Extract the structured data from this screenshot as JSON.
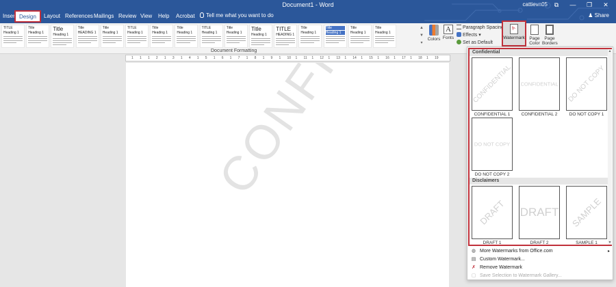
{
  "titlebar": {
    "title": "Document1 - Word",
    "user": "cattievn05",
    "buttons": {
      "ribbon_options": "⧉",
      "minimize": "—",
      "restore": "❐",
      "close": "✕"
    }
  },
  "tabs": [
    {
      "label": "Insert"
    },
    {
      "label": "Design",
      "active": true
    },
    {
      "label": "Layout"
    },
    {
      "label": "References"
    },
    {
      "label": "Mailings"
    },
    {
      "label": "Review"
    },
    {
      "label": "View"
    },
    {
      "label": "Help"
    },
    {
      "label": "Acrobat"
    }
  ],
  "tell_me": "Tell me what you want to do",
  "share": "Share",
  "style_gallery": {
    "items": [
      {
        "title": "TITLE",
        "heading": "Heading 1",
        "big": false
      },
      {
        "title": "Title",
        "heading": "Heading 1",
        "big": false
      },
      {
        "title": "Title",
        "heading": "Heading 1",
        "big": true
      },
      {
        "title": "Title",
        "heading": "HEADING 1",
        "big": false
      },
      {
        "title": "Title",
        "heading": "Heading 1",
        "big": false
      },
      {
        "title": "TITLE",
        "heading": "Heading 1",
        "big": false
      },
      {
        "title": "Title",
        "heading": "Heading 1",
        "big": false
      },
      {
        "title": "Title",
        "heading": "Heading 1",
        "big": false
      },
      {
        "title": "TITLE",
        "heading": "Heading 1",
        "big": false
      },
      {
        "title": "Title",
        "heading": "Heading 1",
        "big": false
      },
      {
        "title": "Title",
        "heading": "Heading 1",
        "big": true
      },
      {
        "title": "TITLE",
        "heading": "HEADING 1",
        "big": true
      },
      {
        "title": "Title",
        "heading": "Heading 1",
        "big": false
      },
      {
        "title": "Title",
        "heading": "Heading 1",
        "big": false
      },
      {
        "title": "Title",
        "heading": "Heading 1",
        "big": false
      },
      {
        "title": "Title",
        "heading": "Heading 1",
        "big": false
      }
    ],
    "label": "Document Formatting"
  },
  "ribbon": {
    "colors": "Colors",
    "fonts": "Fonts",
    "fonts_icon": "A",
    "paragraph_spacing": "Paragraph Spacing ▾",
    "effects": "Effects ▾",
    "set_default": "Set as Default",
    "watermark": "Watermark",
    "page_color": "Page Color ▾",
    "page_borders": "Page Borders"
  },
  "ruler": {
    "ticks": [
      "1",
      "1",
      "1",
      "2",
      "1",
      "3",
      "1",
      "4",
      "1",
      "5",
      "1",
      "6",
      "1",
      "7",
      "1",
      "8",
      "1",
      "9",
      "1",
      "10",
      "1",
      "11",
      "1",
      "12",
      "1",
      "13",
      "1",
      "14",
      "1",
      "15",
      "1",
      "16",
      "1",
      "17",
      "1",
      "18",
      "1",
      "19"
    ]
  },
  "document": {
    "background_watermark": "CONFIDENTIAL"
  },
  "watermark_menu": {
    "sections": [
      {
        "heading": "Confidential",
        "items": [
          {
            "caption": "CONFIDENTIAL 1",
            "text": "CONFIDENTIAL",
            "style": "diag"
          },
          {
            "caption": "CONFIDENTIAL 2",
            "text": "CONFIDENTIAL",
            "style": "horiz"
          },
          {
            "caption": "DO NOT COPY 1",
            "text": "DO NOT COPY",
            "style": "diag"
          },
          {
            "caption": "DO NOT COPY 2",
            "text": "DO NOT COPY",
            "style": "horiz"
          }
        ]
      },
      {
        "heading": "Disclaimers",
        "items": [
          {
            "caption": "DRAFT 1",
            "text": "DRAFT",
            "style": "diag-big"
          },
          {
            "caption": "DRAFT 2",
            "text": "DRAFT",
            "style": "horiz-big"
          },
          {
            "caption": "SAMPLE 1",
            "text": "SAMPLE",
            "style": "diag-big"
          }
        ]
      }
    ],
    "actions": [
      {
        "label": "More Watermarks from Office.com",
        "icon": "globe-icon",
        "glyph": "◍",
        "submenu": true,
        "disabled": false
      },
      {
        "label": "Custom Watermark...",
        "icon": "custom-watermark-icon",
        "glyph": "▤",
        "submenu": false,
        "disabled": false
      },
      {
        "label": "Remove Watermark",
        "icon": "remove-watermark-icon",
        "glyph": "✗",
        "submenu": false,
        "disabled": false
      },
      {
        "label": "Save Selection to Watermark Gallery...",
        "icon": "save-to-gallery-icon",
        "glyph": "▢",
        "submenu": false,
        "disabled": true
      }
    ]
  },
  "colors": {
    "title_bar": "#2b579a",
    "highlight": "#c0303a",
    "ribbon_bg": "#f3f3f3"
  }
}
